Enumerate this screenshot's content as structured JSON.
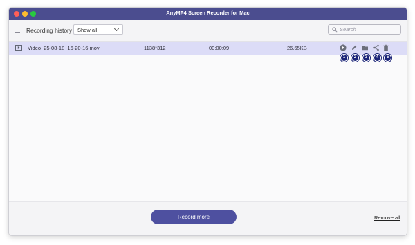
{
  "window": {
    "title": "AnyMP4 Screen Recorder for Mac"
  },
  "toolbar": {
    "heading": "Recording history",
    "filter": {
      "selected": "Show all"
    },
    "search": {
      "placeholder": "Search"
    }
  },
  "recordings": [
    {
      "name": "Video_25-08-18_16-20-16.mov",
      "resolution": "1138*312",
      "duration": "00:00:09",
      "size": "26.65KB",
      "actions": [
        {
          "icon": "play-icon",
          "badge": "1"
        },
        {
          "icon": "edit-icon",
          "badge": "2"
        },
        {
          "icon": "folder-icon",
          "badge": "3"
        },
        {
          "icon": "share-icon",
          "badge": "4"
        },
        {
          "icon": "trash-icon",
          "badge": "5"
        }
      ]
    }
  ],
  "footer": {
    "record_more": "Record more",
    "remove_all": "Remove all"
  },
  "colors": {
    "titlebar": "#4b4d8f",
    "selected_row": "#dcdcf7",
    "primary_button": "#4e50a0",
    "badge": "#1b2478"
  }
}
